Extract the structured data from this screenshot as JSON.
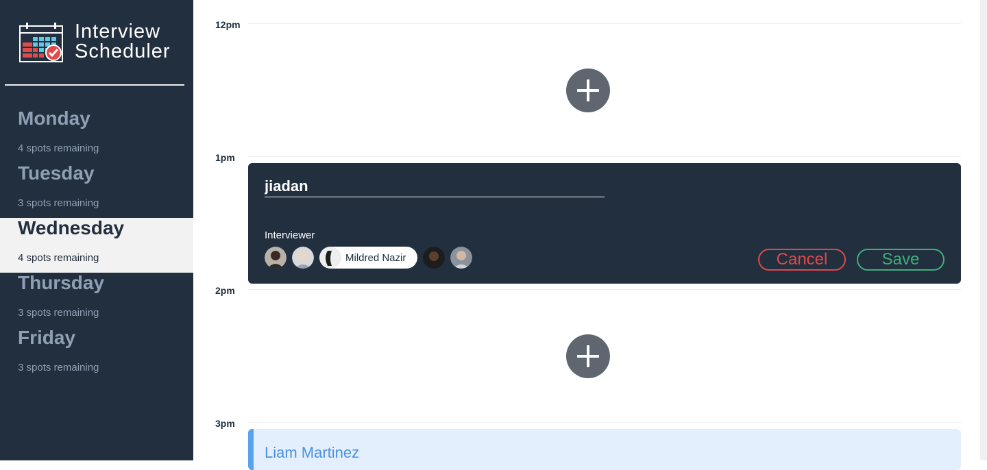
{
  "app": {
    "title_line1": "Interview",
    "title_line2": "Scheduler"
  },
  "sidebar": {
    "days": [
      {
        "name": "Monday",
        "spots": "4 spots remaining",
        "selected": false
      },
      {
        "name": "Tuesday",
        "spots": "3 spots remaining",
        "selected": false
      },
      {
        "name": "Wednesday",
        "spots": "4 spots remaining",
        "selected": true
      },
      {
        "name": "Thursday",
        "spots": "3 spots remaining",
        "selected": false
      },
      {
        "name": "Friday",
        "spots": "3 spots remaining",
        "selected": false
      }
    ]
  },
  "schedule": {
    "hours": [
      "12pm",
      "1pm",
      "2pm",
      "3pm"
    ],
    "add_icon": "plus-icon"
  },
  "form": {
    "student_value": "jiadan",
    "interviewer_label": "Interviewer",
    "selected_interviewer": "Mildred Nazir",
    "interviewer_count": 5,
    "cancel_label": "Cancel",
    "save_label": "Save"
  },
  "appointment": {
    "student": "Liam Martinez"
  },
  "colors": {
    "sidebar_bg": "#222f3e",
    "cancel": "#de4a4a",
    "save": "#3fae7e",
    "appointment_accent": "#5aa2ed",
    "appointment_bg": "#e3effc"
  }
}
